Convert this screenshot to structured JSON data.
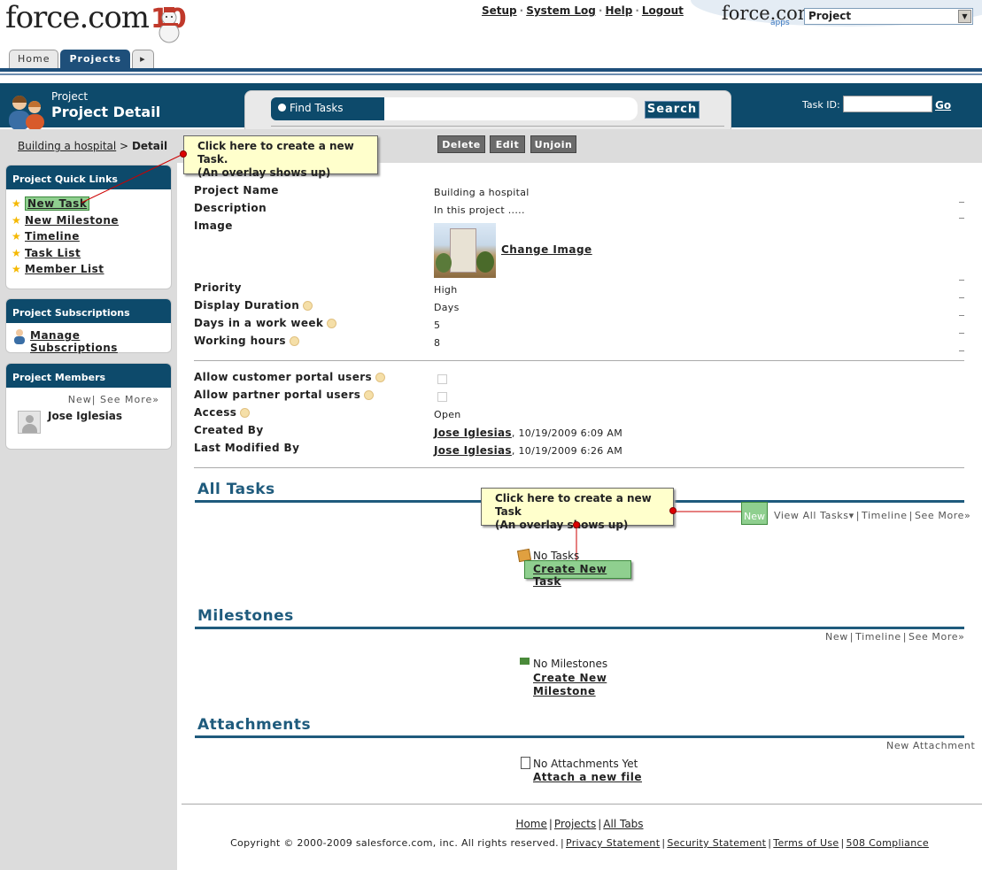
{
  "header": {
    "logo_text": "force.com",
    "logo_suffix": "10",
    "top_links": [
      "Setup",
      "System Log",
      "Help",
      "Logout"
    ],
    "apps_logo": "force.com",
    "apps_sub": "apps",
    "app_selector_value": "Project"
  },
  "tabs": [
    "Home",
    "Projects"
  ],
  "page": {
    "object_type": "Project",
    "title": "Project Detail"
  },
  "search": {
    "label": "Find Tasks",
    "button": "Search",
    "taskid_label": "Task ID:",
    "go": "Go"
  },
  "breadcrumb": {
    "link": "Building a hospital",
    "separator": ">",
    "current": "Detail"
  },
  "actions": [
    "Delete",
    "Edit",
    "Unjoin"
  ],
  "callouts": {
    "sidebar_line1": "Click here to create a new Task.",
    "sidebar_line2": "(An overlay shows up)",
    "tasks_line1": "Click here to create a new Task",
    "tasks_line2": "(An overlay shows up)"
  },
  "sidebar": {
    "quick_links_title": "Project Quick Links",
    "quick_links": [
      "New Task",
      "New Milestone",
      "Timeline",
      "Task List",
      "Member List"
    ],
    "subscriptions_title": "Project Subscriptions",
    "manage_subscriptions": "Manage Subscriptions",
    "members_title": "Project Members",
    "members_new": "New",
    "members_see_more": "See More»",
    "members": [
      "Jose Iglesias"
    ]
  },
  "details": {
    "project_name_label": "Project Name",
    "project_name": "Building a hospital",
    "description_label": "Description",
    "description": "In this project .....",
    "image_label": "Image",
    "change_image": "Change Image",
    "priority_label": "Priority",
    "priority": "High",
    "display_duration_label": "Display Duration",
    "display_duration": "Days",
    "days_week_label": "Days in a work week",
    "days_week": "5",
    "working_hours_label": "Working hours",
    "working_hours": "8",
    "allow_customer_label": "Allow customer portal users",
    "allow_partner_label": "Allow partner portal users",
    "access_label": "Access",
    "access": "Open",
    "created_by_label": "Created By",
    "created_by_user": "Jose Iglesias",
    "created_by_date": ", 10/19/2009 6:09 AM",
    "modified_by_label": "Last Modified By",
    "modified_by_user": "Jose Iglesias",
    "modified_by_date": ", 10/19/2009 6:26 AM"
  },
  "tasks": {
    "title": "All Tasks",
    "new": "New",
    "view_all": "View All Tasks",
    "timeline": "Timeline",
    "see_more": "See More»",
    "empty": "No Tasks",
    "create": "Create New Task"
  },
  "milestones": {
    "title": "Milestones",
    "new": "New",
    "timeline": "Timeline",
    "see_more": "See More»",
    "empty": "No Milestones",
    "create_line1": "Create New",
    "create_line2": "Milestone"
  },
  "attachments": {
    "title": "Attachments",
    "new": "New Attachment",
    "empty": "No Attachments Yet",
    "attach": "Attach a new file"
  },
  "footer": {
    "links": [
      "Home",
      "Projects",
      "All Tabs"
    ],
    "copyright": "Copyright © 2000-2009 salesforce.com, inc. All rights reserved.",
    "legal_links": [
      "Privacy Statement",
      "Security Statement",
      "Terms of Use",
      "508 Compliance"
    ]
  },
  "colors": {
    "header_blue": "#0d4a6b",
    "section_blue": "#1f5b7d",
    "callout_yellow": "#ffffcc",
    "highlight_green": "#8fcf8f",
    "sidebar_gray": "#dcdcdc"
  }
}
